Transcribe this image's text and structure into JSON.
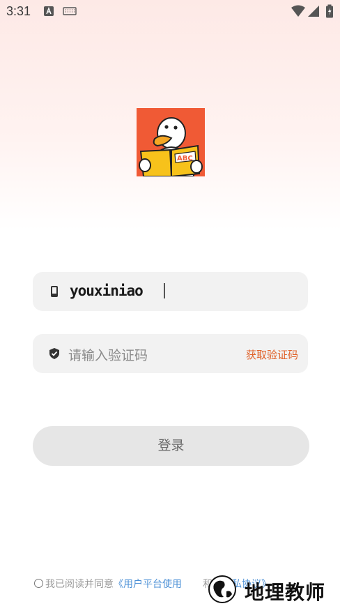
{
  "status_bar": {
    "time": "3:31",
    "icons": [
      "text-notification-icon",
      "keyboard-icon",
      "wifi-icon",
      "signal-icon",
      "battery-icon"
    ]
  },
  "logo": {
    "name": "duck-reading-logo",
    "background_color": "#f05a35",
    "book_text": "ABC"
  },
  "login_form": {
    "phone_value": "youxiniao",
    "code_placeholder": "请输入验证码",
    "get_code_label": "获取验证码",
    "login_label": "登录"
  },
  "agreement": {
    "prefix": "我已阅读并同意",
    "user_agreement": "《用户平台使用",
    "connector": "和",
    "privacy": "《隐私协议》"
  },
  "watermark": {
    "text": "地理教师"
  },
  "colors": {
    "accent": "#e0622a",
    "link": "#4a8fd6",
    "field_bg": "#f2f2f2",
    "button_bg": "#e6e6e6"
  }
}
